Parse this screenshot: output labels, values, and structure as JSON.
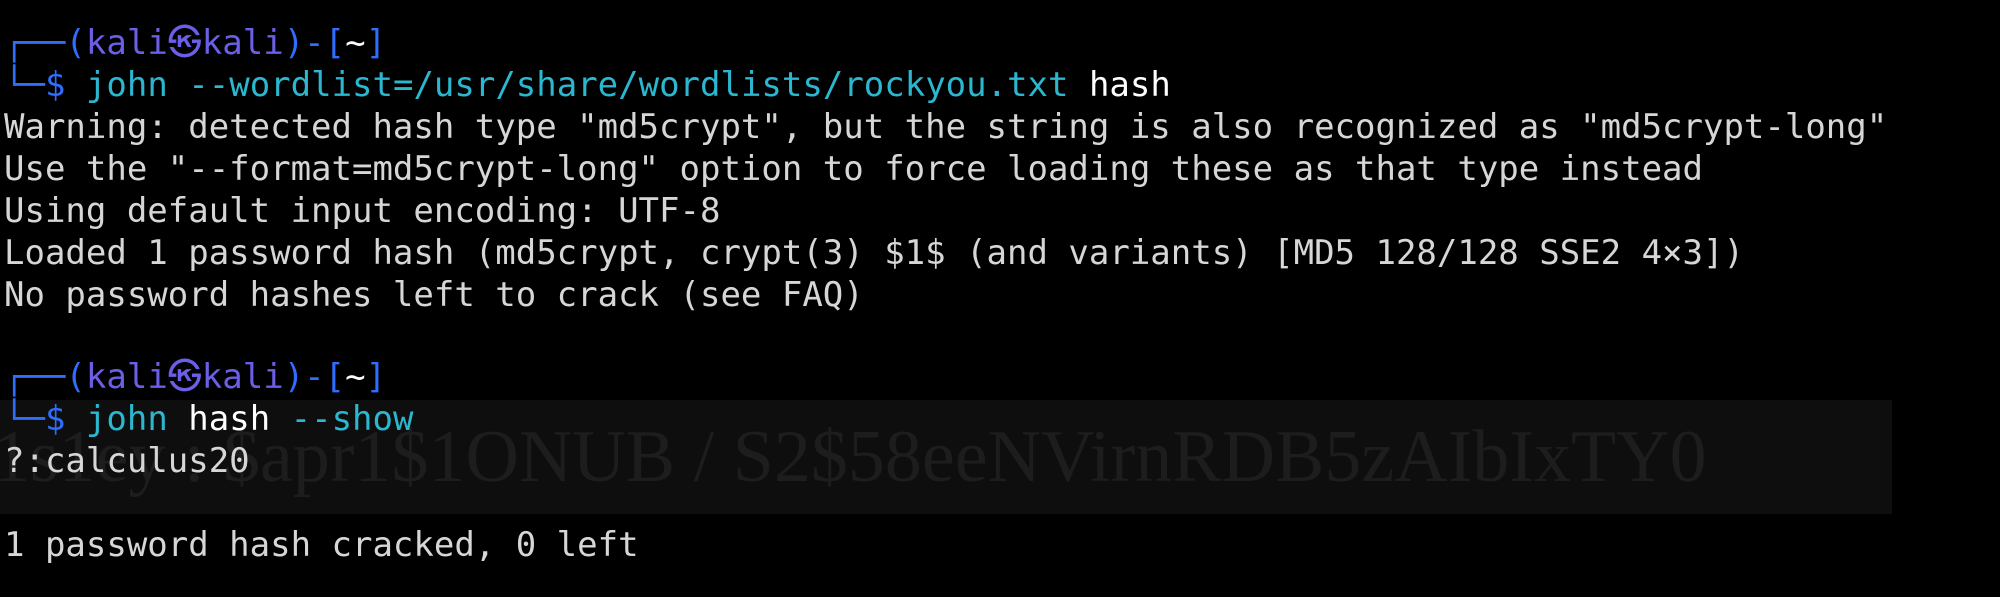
{
  "terminal": {
    "prompt1": {
      "corner_top": "┌──",
      "open_paren": "(",
      "user": "kali",
      "at_symbol": "㉿",
      "host": "kali",
      "close_paren": ")-[",
      "dir": "~",
      "close_bracket": "]",
      "corner_bottom": "└─",
      "dollar": "$",
      "command": "john",
      "args": " --wordlist=/usr/share/wordlists/rockyou.txt",
      "target": " hash"
    },
    "output1": [
      "Warning: detected hash type \"md5crypt\", but the string is also recognized as \"md5crypt-long\"",
      "Use the \"--format=md5crypt-long\" option to force loading these as that type instead",
      "Using default input encoding: UTF-8",
      "Loaded 1 password hash (md5crypt, crypt(3) $1$ (and variants) [MD5 128/128 SSE2 4×3])",
      "No password hashes left to crack (see FAQ)"
    ],
    "prompt2": {
      "corner_top": "┌──",
      "open_paren": "(",
      "user": "kali",
      "at_symbol": "㉿",
      "host": "kali",
      "close_paren": ")-[",
      "dir": "~",
      "close_bracket": "]",
      "corner_bottom": "└─",
      "dollar": "$",
      "command": "john",
      "target": " hash",
      "args": " --show"
    },
    "output2": {
      "result": "?:calculus20",
      "summary": "1 password hash cracked, 0 left"
    },
    "overlay_text": "a1s1ey : $apr1$1ONUB / S2$58eeNVirnRDB5zAIbIxTY0"
  },
  "colors": {
    "background": "#000000",
    "prompt_frame": "#2f6dff",
    "prompt_user": "#6a5fe6",
    "command": "#2bb7cf",
    "argument_white": "#ffffff",
    "output_text": "#d6d6d6"
  }
}
